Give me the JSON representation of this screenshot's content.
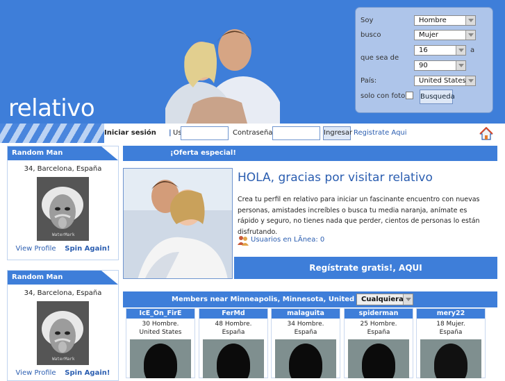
{
  "header": {
    "logo": "relativo"
  },
  "search": {
    "soy_label": "Soy",
    "soy_value": "Hombre",
    "busco_label": "busco",
    "busco_value": "Mujer",
    "age_label": "que sea de",
    "age_from": "16",
    "age_sep": "a",
    "age_to": "90",
    "pais_label": "País:",
    "pais_value": "United States",
    "foto_label": "solo con foto",
    "button": "Busqueda"
  },
  "login": {
    "title": "Iniciar sesión",
    "separator": "|",
    "user_label": "Usuario:",
    "pass_label": "Contraseña:",
    "button": "Ingresar",
    "register_link": "Registrate Aqui"
  },
  "sidebar": [
    {
      "title": "Random Man",
      "location": "34, Barcelona, España",
      "view": "View Profile",
      "spin": "Spin Again!"
    },
    {
      "title": "Random Man",
      "location": "34, Barcelona, España",
      "view": "View Profile",
      "spin": "Spin Again!"
    }
  ],
  "offer": {
    "header": "¡Oferta especial!",
    "title": "HOLA, gracias por visitar relativo",
    "text": "Crea tu perfil en relativo para iniciar un fascinante encuentro con nuevas personas, amistades increíbles o busca tu media naranja, anímate es rápido y seguro, no tienes nada que perder, cientos de personas lo están disfrutando.",
    "online_label": "Usuarios en LÃnea:",
    "online_count": "0",
    "register_bar": "Regístrate gratis!, AQUI"
  },
  "members": {
    "title": "Members near Minneapolis, Minnesota, United States",
    "filter": "Cualquiera",
    "list": [
      {
        "name": "IcE_On_FirE",
        "info": "30 Hombre.",
        "loc": "United States"
      },
      {
        "name": "FerMd",
        "info": "48 Hombre.",
        "loc": "España"
      },
      {
        "name": "malaguita",
        "info": "34 Hombre.",
        "loc": "España"
      },
      {
        "name": "spiderman",
        "info": "25 Hombre.",
        "loc": "España"
      },
      {
        "name": "mery22",
        "info": "18 Mujer.",
        "loc": "España"
      }
    ]
  },
  "colors": {
    "brand_blue": "#3e7ed9",
    "panel": "#aec5ea",
    "link": "#2a5db0"
  }
}
